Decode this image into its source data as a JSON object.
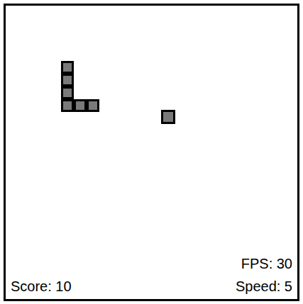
{
  "board": {
    "snake": [
      {
        "col": 4,
        "row": 4
      },
      {
        "col": 4,
        "row": 5
      },
      {
        "col": 4,
        "row": 6
      },
      {
        "col": 4,
        "row": 7
      },
      {
        "col": 5,
        "row": 7
      },
      {
        "col": 6,
        "row": 7
      }
    ],
    "food": {
      "col": 12,
      "row": 8
    }
  },
  "hud": {
    "score": "Score: 10",
    "fps": "FPS: 30",
    "speed": "Speed: 5"
  }
}
